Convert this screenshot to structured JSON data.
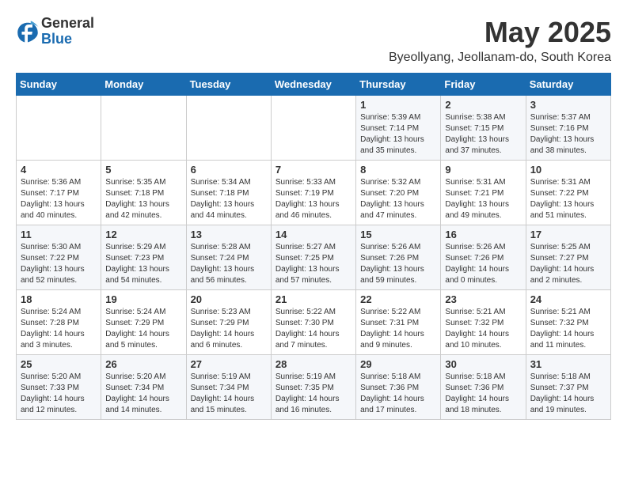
{
  "header": {
    "logo_general": "General",
    "logo_blue": "Blue",
    "month": "May 2025",
    "location": "Byeollyang, Jeollanam-do, South Korea"
  },
  "weekdays": [
    "Sunday",
    "Monday",
    "Tuesday",
    "Wednesday",
    "Thursday",
    "Friday",
    "Saturday"
  ],
  "weeks": [
    [
      {
        "day": "",
        "info": ""
      },
      {
        "day": "",
        "info": ""
      },
      {
        "day": "",
        "info": ""
      },
      {
        "day": "",
        "info": ""
      },
      {
        "day": "1",
        "info": "Sunrise: 5:39 AM\nSunset: 7:14 PM\nDaylight: 13 hours\nand 35 minutes."
      },
      {
        "day": "2",
        "info": "Sunrise: 5:38 AM\nSunset: 7:15 PM\nDaylight: 13 hours\nand 37 minutes."
      },
      {
        "day": "3",
        "info": "Sunrise: 5:37 AM\nSunset: 7:16 PM\nDaylight: 13 hours\nand 38 minutes."
      }
    ],
    [
      {
        "day": "4",
        "info": "Sunrise: 5:36 AM\nSunset: 7:17 PM\nDaylight: 13 hours\nand 40 minutes."
      },
      {
        "day": "5",
        "info": "Sunrise: 5:35 AM\nSunset: 7:18 PM\nDaylight: 13 hours\nand 42 minutes."
      },
      {
        "day": "6",
        "info": "Sunrise: 5:34 AM\nSunset: 7:18 PM\nDaylight: 13 hours\nand 44 minutes."
      },
      {
        "day": "7",
        "info": "Sunrise: 5:33 AM\nSunset: 7:19 PM\nDaylight: 13 hours\nand 46 minutes."
      },
      {
        "day": "8",
        "info": "Sunrise: 5:32 AM\nSunset: 7:20 PM\nDaylight: 13 hours\nand 47 minutes."
      },
      {
        "day": "9",
        "info": "Sunrise: 5:31 AM\nSunset: 7:21 PM\nDaylight: 13 hours\nand 49 minutes."
      },
      {
        "day": "10",
        "info": "Sunrise: 5:31 AM\nSunset: 7:22 PM\nDaylight: 13 hours\nand 51 minutes."
      }
    ],
    [
      {
        "day": "11",
        "info": "Sunrise: 5:30 AM\nSunset: 7:22 PM\nDaylight: 13 hours\nand 52 minutes."
      },
      {
        "day": "12",
        "info": "Sunrise: 5:29 AM\nSunset: 7:23 PM\nDaylight: 13 hours\nand 54 minutes."
      },
      {
        "day": "13",
        "info": "Sunrise: 5:28 AM\nSunset: 7:24 PM\nDaylight: 13 hours\nand 56 minutes."
      },
      {
        "day": "14",
        "info": "Sunrise: 5:27 AM\nSunset: 7:25 PM\nDaylight: 13 hours\nand 57 minutes."
      },
      {
        "day": "15",
        "info": "Sunrise: 5:26 AM\nSunset: 7:26 PM\nDaylight: 13 hours\nand 59 minutes."
      },
      {
        "day": "16",
        "info": "Sunrise: 5:26 AM\nSunset: 7:26 PM\nDaylight: 14 hours\nand 0 minutes."
      },
      {
        "day": "17",
        "info": "Sunrise: 5:25 AM\nSunset: 7:27 PM\nDaylight: 14 hours\nand 2 minutes."
      }
    ],
    [
      {
        "day": "18",
        "info": "Sunrise: 5:24 AM\nSunset: 7:28 PM\nDaylight: 14 hours\nand 3 minutes."
      },
      {
        "day": "19",
        "info": "Sunrise: 5:24 AM\nSunset: 7:29 PM\nDaylight: 14 hours\nand 5 minutes."
      },
      {
        "day": "20",
        "info": "Sunrise: 5:23 AM\nSunset: 7:29 PM\nDaylight: 14 hours\nand 6 minutes."
      },
      {
        "day": "21",
        "info": "Sunrise: 5:22 AM\nSunset: 7:30 PM\nDaylight: 14 hours\nand 7 minutes."
      },
      {
        "day": "22",
        "info": "Sunrise: 5:22 AM\nSunset: 7:31 PM\nDaylight: 14 hours\nand 9 minutes."
      },
      {
        "day": "23",
        "info": "Sunrise: 5:21 AM\nSunset: 7:32 PM\nDaylight: 14 hours\nand 10 minutes."
      },
      {
        "day": "24",
        "info": "Sunrise: 5:21 AM\nSunset: 7:32 PM\nDaylight: 14 hours\nand 11 minutes."
      }
    ],
    [
      {
        "day": "25",
        "info": "Sunrise: 5:20 AM\nSunset: 7:33 PM\nDaylight: 14 hours\nand 12 minutes."
      },
      {
        "day": "26",
        "info": "Sunrise: 5:20 AM\nSunset: 7:34 PM\nDaylight: 14 hours\nand 14 minutes."
      },
      {
        "day": "27",
        "info": "Sunrise: 5:19 AM\nSunset: 7:34 PM\nDaylight: 14 hours\nand 15 minutes."
      },
      {
        "day": "28",
        "info": "Sunrise: 5:19 AM\nSunset: 7:35 PM\nDaylight: 14 hours\nand 16 minutes."
      },
      {
        "day": "29",
        "info": "Sunrise: 5:18 AM\nSunset: 7:36 PM\nDaylight: 14 hours\nand 17 minutes."
      },
      {
        "day": "30",
        "info": "Sunrise: 5:18 AM\nSunset: 7:36 PM\nDaylight: 14 hours\nand 18 minutes."
      },
      {
        "day": "31",
        "info": "Sunrise: 5:18 AM\nSunset: 7:37 PM\nDaylight: 14 hours\nand 19 minutes."
      }
    ]
  ]
}
